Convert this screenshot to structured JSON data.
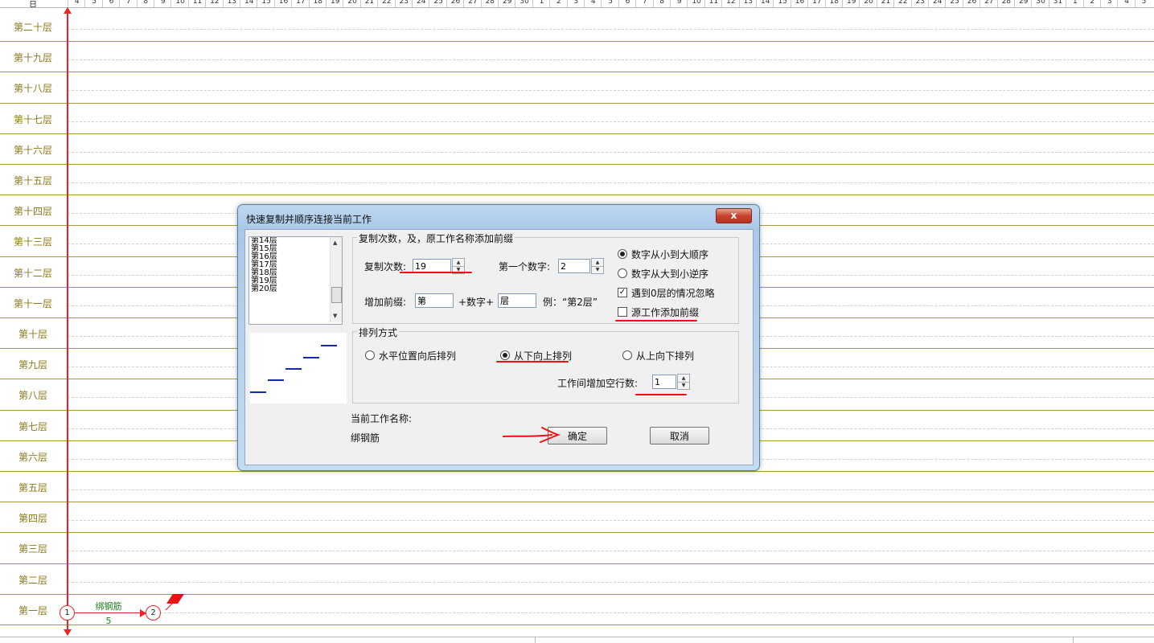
{
  "ruler": {
    "corner_label": "日",
    "ticks": [
      "4",
      "5",
      "6",
      "7",
      "8",
      "9",
      "10",
      "11",
      "12",
      "13",
      "14",
      "15",
      "16",
      "17",
      "18",
      "19",
      "20",
      "21",
      "22",
      "23",
      "24",
      "25",
      "26",
      "27",
      "28",
      "29",
      "30",
      "1",
      "2",
      "3",
      "4",
      "5",
      "6",
      "7",
      "8",
      "9",
      "10",
      "11",
      "12",
      "13",
      "14",
      "15",
      "16",
      "17",
      "18",
      "19",
      "20",
      "21",
      "22",
      "23",
      "24",
      "25",
      "26",
      "27",
      "28",
      "29",
      "30",
      "31",
      "1",
      "2",
      "3",
      "4",
      "5"
    ]
  },
  "rows": [
    "第二十层",
    "第十九层",
    "第十八层",
    "第十七层",
    "第十六层",
    "第十五层",
    "第十四层",
    "第十三层",
    "第十二层",
    "第十一层",
    "第十层",
    "第九层",
    "第八层",
    "第七层",
    "第六层",
    "第五层",
    "第四层",
    "第三层",
    "第二层",
    "第一层"
  ],
  "task": {
    "start_node": "1",
    "end_node": "2",
    "name": "绑钢筋",
    "duration": "5"
  },
  "dialog": {
    "title": "快速复制并顺序连接当前工作",
    "close_label": "x",
    "floor_list": [
      "第14层",
      "第15层",
      "第16层",
      "第17层",
      "第18层",
      "第19层",
      "第20层"
    ],
    "copy_group": {
      "title": "复制次数，及，原工作名称添加前缀",
      "copies_label": "复制次数:",
      "copies_value": "19",
      "first_number_label": "第一个数字:",
      "first_number_value": "2",
      "prefix_label": "增加前缀:",
      "prefix_value": "第",
      "plus_number_label": "+数字+",
      "suffix_value": "层",
      "example_label": "例：“第2层”",
      "order_asc": "数字从小到大顺序",
      "order_desc": "数字从大到小逆序",
      "ignore_zero": "遇到0层的情况忽略",
      "add_prefix_source": "源工作添加前缀"
    },
    "arrange_group": {
      "title": "排列方式",
      "horizontal": "水平位置向后排列",
      "bottom_up": "从下向上排列",
      "top_down": "从上向下排列",
      "blank_rows_label": "工作间增加空行数:",
      "blank_rows_value": "1"
    },
    "current_work_label": "当前工作名称:",
    "current_work_value": "绑钢筋",
    "ok_label": "确定",
    "cancel_label": "取消"
  },
  "colors": {
    "row_line": "#a29c3a",
    "row_label": "#8c7a1c",
    "axis": "#ee2222",
    "annotation": "#ee1111",
    "task_text": "#1e7f1e"
  }
}
